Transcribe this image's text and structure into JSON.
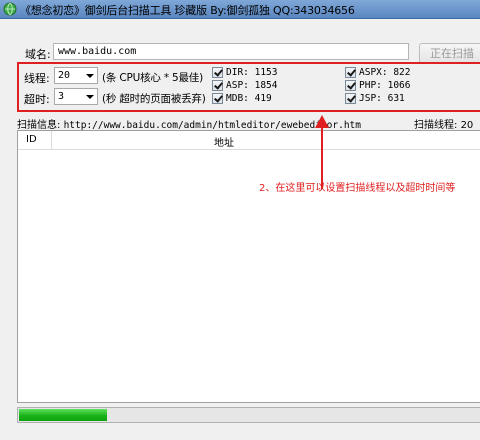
{
  "window": {
    "title": "《想念初恋》御剑后台扫描工具 珍藏版 By:御剑孤独 QQ:343034656"
  },
  "domain": {
    "label": "域名:",
    "value": "www.baidu.com"
  },
  "scan_button": {
    "label": "正在扫描"
  },
  "threads": {
    "label": "线程:",
    "selected": "20",
    "note": "(条 CPU核心 * 5最佳)"
  },
  "timeout": {
    "label": "超时:",
    "selected": "3",
    "note": "(秒 超时的页面被丢弃)"
  },
  "dictionaries": [
    {
      "label": "DIR: 1153",
      "checked": true
    },
    {
      "label": "ASP: 1854",
      "checked": true
    },
    {
      "label": "MDB: 419",
      "checked": true
    },
    {
      "label": "ASPX: 822",
      "checked": true
    },
    {
      "label": "PHP: 1066",
      "checked": true
    },
    {
      "label": "JSP: 631",
      "checked": true
    }
  ],
  "scan_info": {
    "label": "扫描信息:",
    "url": "http://www.baidu.com/admin/htmleditor/ewebeditor.htm"
  },
  "scan_threads": {
    "label": "扫描线程:",
    "value": "20"
  },
  "results_table": {
    "columns": [
      "ID",
      "地址"
    ],
    "rows": []
  },
  "annotation": {
    "text": "2、在这里可以设置扫描线程以及超时时间等",
    "color": "#e02020"
  },
  "progress": {
    "fraction": 0.19,
    "color": "#19b319"
  },
  "icons": {
    "app": "globe-icon",
    "dropdown": "chevron-down-icon",
    "checkbox": "check-icon"
  }
}
